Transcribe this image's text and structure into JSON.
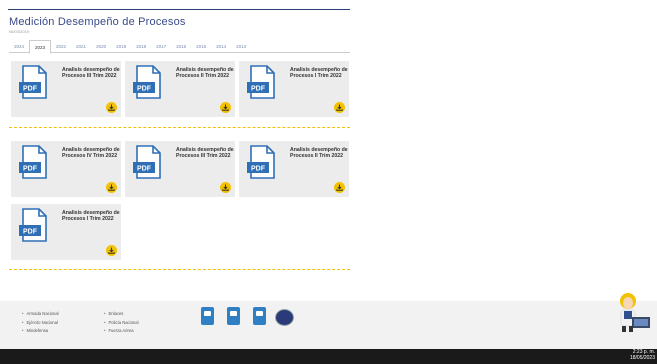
{
  "header": {
    "title": "Medición Desempeño de Procesos",
    "date": "06/03/2019"
  },
  "tabs": [
    {
      "label": "2024",
      "active": false
    },
    {
      "label": "2023",
      "active": true
    },
    {
      "label": "2022",
      "active": false
    },
    {
      "label": "2021",
      "active": false
    },
    {
      "label": "2020",
      "active": false
    },
    {
      "label": "2019",
      "active": false
    },
    {
      "label": "2018",
      "active": false
    },
    {
      "label": "2017",
      "active": false
    },
    {
      "label": "2016",
      "active": false
    },
    {
      "label": "2015",
      "active": false
    },
    {
      "label": "2014",
      "active": false
    },
    {
      "label": "2013",
      "active": false
    }
  ],
  "documents": [
    {
      "label": "Analisis desempeño de Procesos III Trim 2022",
      "icon": "pdf-icon",
      "pdf_text": "PDF"
    },
    {
      "label": "Analisis desempeño de Procesos II Trim 2022",
      "icon": "pdf-icon",
      "pdf_text": "PDF"
    },
    {
      "label": "Analisis desempeño de Procesos I Trim 2022",
      "icon": "pdf-icon",
      "pdf_text": "PDF"
    },
    {
      "label": "Analisis desempeño de Procesos IV Trim 2022",
      "icon": "pdf-icon",
      "pdf_text": "PDF"
    },
    {
      "label": "Analisis desempeño de Procesos III Trim 2022",
      "icon": "pdf-icon",
      "pdf_text": "PDF"
    },
    {
      "label": "Analisis desempeño de Procesos II Trim 2022",
      "icon": "pdf-icon",
      "pdf_text": "PDF"
    },
    {
      "label": "Analisis desempeño de Procesos I Trim 2022",
      "icon": "pdf-icon",
      "pdf_text": "PDF"
    }
  ],
  "footer": {
    "links_col1": [
      "Armada Nacional",
      "Ejército Nacional",
      "Mindefensa"
    ],
    "links_col2": [
      "Enlaces",
      "Policía Nacional",
      "Fuerza Aérea"
    ]
  },
  "taskbar": {
    "time": "2:23 p. m.",
    "date": "18/05/2023"
  },
  "colors": {
    "accent": "#f2c200",
    "title": "#3a4a8a",
    "pdf_blue": "#2f6fb5"
  }
}
